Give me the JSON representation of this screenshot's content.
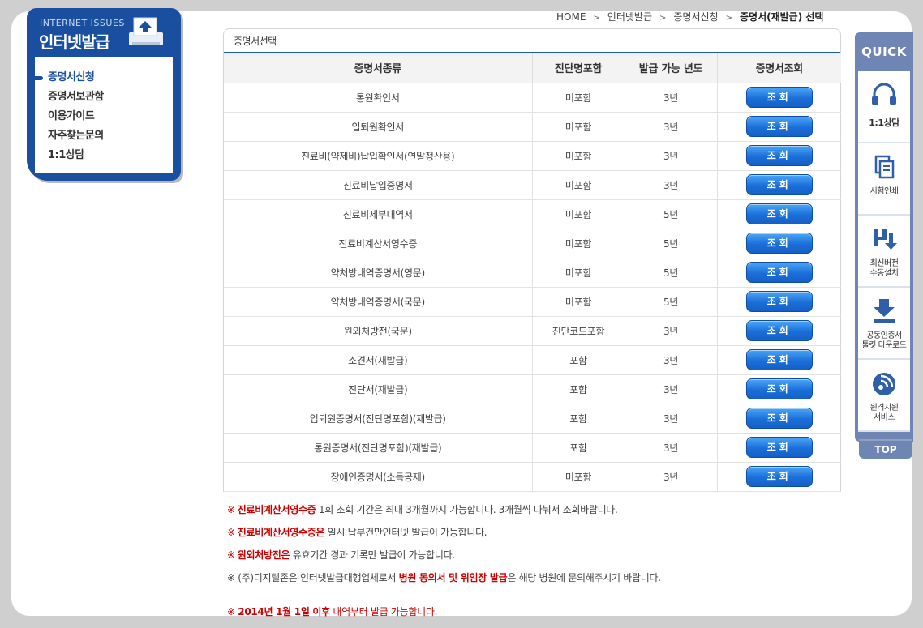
{
  "breadcrumb": {
    "home": "HOME",
    "level1": "인터넷발급",
    "level2": "증명서신청",
    "current": "증명서(재발급) 선택"
  },
  "sidebar": {
    "eng_title": "INTERNET ISSUES",
    "title": "인터넷발급",
    "items": [
      {
        "label": "증명서신청"
      },
      {
        "label": "증명서보관함"
      },
      {
        "label": "이용가이드"
      },
      {
        "label": "자주찾는문의"
      },
      {
        "label": "1:1상담"
      }
    ]
  },
  "panel": {
    "title": "증명서선택",
    "columns": [
      "증명서종류",
      "진단명포함",
      "발급 가능 년도",
      "증명서조회"
    ],
    "button_label": "조회",
    "rows": [
      {
        "name": "통원확인서",
        "diag": "미포함",
        "years": "3년"
      },
      {
        "name": "입퇴원확인서",
        "diag": "미포함",
        "years": "3년"
      },
      {
        "name": "진료비(약제비)납입확인서(연말정산용)",
        "diag": "미포함",
        "years": "3년"
      },
      {
        "name": "진료비납입증명서",
        "diag": "미포함",
        "years": "3년"
      },
      {
        "name": "진료비세부내역서",
        "diag": "미포함",
        "years": "5년"
      },
      {
        "name": "진료비계산서영수증",
        "diag": "미포함",
        "years": "5년"
      },
      {
        "name": "약처방내역증명서(영문)",
        "diag": "미포함",
        "years": "5년"
      },
      {
        "name": "약처방내역증명서(국문)",
        "diag": "미포함",
        "years": "5년"
      },
      {
        "name": "원외처방전(국문)",
        "diag": "진단코드포함",
        "years": "3년"
      },
      {
        "name": "소견서(재발급)",
        "diag": "포함",
        "years": "3년"
      },
      {
        "name": "진단서(재발급)",
        "diag": "포함",
        "years": "3년"
      },
      {
        "name": "입퇴원증명서(진단명포함)(재발급)",
        "diag": "포함",
        "years": "3년"
      },
      {
        "name": "통원증명서(진단명포함)(재발급)",
        "diag": "포함",
        "years": "3년"
      },
      {
        "name": "장애인증명서(소득공제)",
        "diag": "미포함",
        "years": "3년"
      }
    ]
  },
  "notes": {
    "mark": "※",
    "n1_em": "진료비계산서영수증",
    "n1_text": " 1회 조회 기간은 최대 3개월까지 가능합니다. 3개월씩 나눠서 조회바랍니다.",
    "n2_em": "진료비계산서영수증은",
    "n2_text": " 일시 납부건만인터넷 발급이 가능합니다.",
    "n3_em": "원외처방전은",
    "n3_text": " 유효기간 경과 기록만 발급이 가능합니다.",
    "n4_pre": " (주)디지털존은 인터넷발급대행업체로서 ",
    "n4_em": "병원 동의서 및 위임장 발급",
    "n4_post": "은 해당 병원에 문의해주시기 바랍니다.",
    "n5_em": "2014년 1월 1일 이후",
    "n5_text": " 내역부터 발급 가능합니다."
  },
  "quick": {
    "title": "QUICK",
    "items": [
      {
        "label": "1:1상담",
        "icon": "headset-icon"
      },
      {
        "label": "시험인쇄",
        "icon": "document-copy-icon"
      },
      {
        "label": "최신버전\n수동설치",
        "icon": "install-icon"
      },
      {
        "label": "공동인증서\n툴킷 다운로드",
        "icon": "download-icon"
      },
      {
        "label": "원격지원\n서비스",
        "icon": "remote-support-icon"
      }
    ],
    "top_label": "TOP"
  },
  "colors": {
    "brand_blue": "#1a4fa0",
    "button_blue": "#1b6fd9",
    "quick_bar": "#6f86b4",
    "note_red": "#cc0000"
  }
}
